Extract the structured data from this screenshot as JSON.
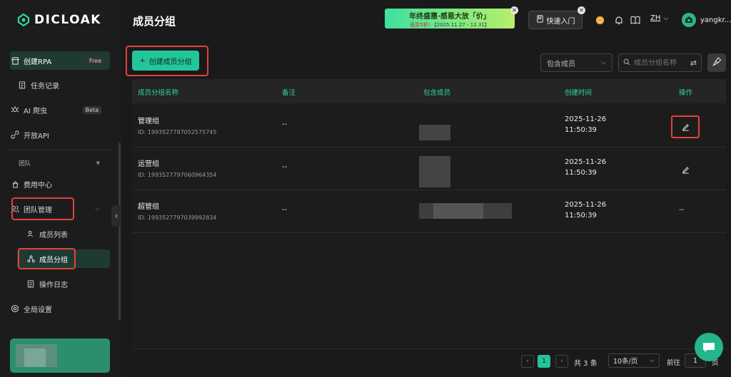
{
  "brand": {
    "name": "DICLOAK"
  },
  "sidebar": {
    "items": [
      {
        "label": "创建RPA",
        "badge": "Free",
        "icon": "store-icon"
      },
      {
        "label": "任务记录",
        "icon": "task-icon"
      },
      {
        "label": "AI 爬虫",
        "badge": "Beta",
        "icon": "spider-icon"
      },
      {
        "label": "开放API",
        "icon": "api-icon"
      },
      {
        "label": "团队",
        "icon": ""
      },
      {
        "label": "费用中心",
        "icon": "wallet-icon"
      },
      {
        "label": "团队管理",
        "icon": "team-icon"
      },
      {
        "label": "成员列表",
        "icon": "users-icon"
      },
      {
        "label": "成员分组",
        "icon": "group-icon"
      },
      {
        "label": "操作日志",
        "icon": "log-icon"
      },
      {
        "label": "全局设置",
        "icon": "settings-icon"
      }
    ]
  },
  "header": {
    "title": "成员分组",
    "promo_line1": "年终盛惠·感恩大放「价」",
    "promo_line2_highlight": "低至5折!",
    "promo_line2_date": "【2025.11.27 - 12.31】",
    "quick_start": "快速入门",
    "lang": "ZH",
    "username": "yangkr..."
  },
  "toolbar": {
    "create_label": "创建成员分组",
    "filter_label": "包含成员",
    "search_placeholder": "成员分组名称"
  },
  "table": {
    "headers": [
      "成员分组名称",
      "备注",
      "包含成员",
      "创建时间",
      "操作"
    ],
    "rows": [
      {
        "name": "管理组",
        "id": "ID: 1993527797052575745",
        "note": "--",
        "date": "2025-11-26",
        "time": "11:50:39",
        "op": "edit"
      },
      {
        "name": "运营组",
        "id": "ID: 1993527797060964354",
        "note": "--",
        "date": "2025-11-26",
        "time": "11:50:39",
        "op": "edit"
      },
      {
        "name": "超管组",
        "id": "ID: 1993527797039992834",
        "note": "--",
        "date": "2025-11-26",
        "time": "11:50:39",
        "op": "--"
      }
    ]
  },
  "pagination": {
    "current": "1",
    "total_text": "共 3 条",
    "page_size": "10条/页",
    "goto_label": "前往",
    "goto_value": "1",
    "page_suffix": "页"
  },
  "colors": {
    "accent": "#23c59b",
    "highlight": "#e0433a",
    "background": "#1a1a1a"
  }
}
